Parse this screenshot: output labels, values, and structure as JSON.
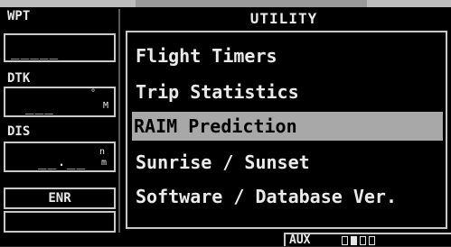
{
  "left_panel": {
    "waypoint": {
      "label": "WPT",
      "value": "_____"
    },
    "desired_track": {
      "label": "DTK",
      "value": "___",
      "unit": "°",
      "unit2": "M"
    },
    "distance": {
      "label": "DIS",
      "value": "__.__",
      "unit": "n",
      "unit2": "m"
    },
    "mode": "ENR"
  },
  "page": {
    "title": "UTILITY",
    "items": [
      {
        "label": "Flight Timers",
        "selected": false
      },
      {
        "label": "Trip Statistics",
        "selected": false
      },
      {
        "label": "RAIM Prediction",
        "selected": true
      },
      {
        "label": "Sunrise / Sunset",
        "selected": false
      },
      {
        "label": "Software / Database Ver.",
        "selected": false
      }
    ]
  },
  "status": {
    "page_group": "AUX",
    "page_count": 4,
    "active_page": 1
  }
}
